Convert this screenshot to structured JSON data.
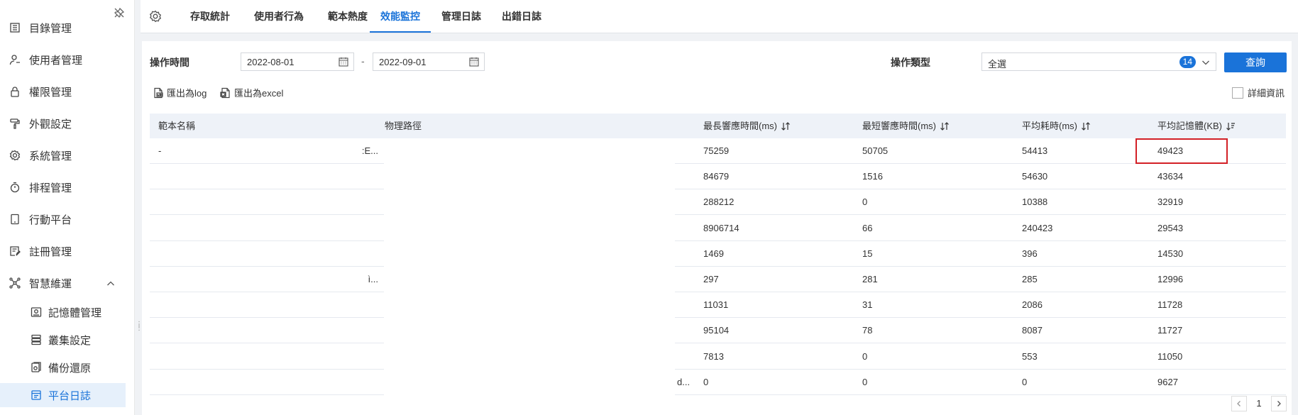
{
  "sidebar": {
    "items": [
      {
        "label": "目錄管理",
        "icon": "list-icon"
      },
      {
        "label": "使用者管理",
        "icon": "user-icon"
      },
      {
        "label": "權限管理",
        "icon": "lock-icon"
      },
      {
        "label": "外觀設定",
        "icon": "paint-roller-icon"
      },
      {
        "label": "系統管理",
        "icon": "gear-icon"
      },
      {
        "label": "排程管理",
        "icon": "timer-icon"
      },
      {
        "label": "行動平台",
        "icon": "tablet-icon"
      },
      {
        "label": "註冊管理",
        "icon": "register-icon"
      },
      {
        "label": "智慧維運",
        "icon": "network-icon"
      }
    ],
    "sub_items": [
      {
        "label": "記憶體管理",
        "icon": "memory-icon"
      },
      {
        "label": "叢集設定",
        "icon": "cluster-icon"
      },
      {
        "label": "備份還原",
        "icon": "backup-icon"
      },
      {
        "label": "平台日誌",
        "icon": "log-icon"
      }
    ]
  },
  "tabs": [
    "存取統計",
    "使用者行為",
    "範本熱度",
    "效能監控",
    "管理日誌",
    "出錯日誌"
  ],
  "active_tab": "效能監控",
  "filters": {
    "time_label": "操作時間",
    "start_date": "2022-08-01",
    "date_separator": "-",
    "end_date": "2022-09-01",
    "type_label": "操作類型",
    "type_value": "全選",
    "type_count": "14",
    "query_button": "查詢"
  },
  "toolbar": {
    "export_log": "匯出為log",
    "export_excel": "匯出為excel",
    "detail_checkbox": "詳細資訊"
  },
  "table": {
    "headers": [
      "範本名稱",
      "物理路徑",
      "最長響應時間(ms)",
      "最短響應時間(ms)",
      "平均耗時(ms)",
      "平均記憶體(KB)"
    ],
    "rows": [
      {
        "name": "-",
        "path_tail": ":E...",
        "max": "75259",
        "min": "50705",
        "avg": "54413",
        "mem": "49423"
      },
      {
        "name": "",
        "path_tail": "",
        "max": "84679",
        "min": "1516",
        "avg": "54630",
        "mem": "43634"
      },
      {
        "name": "",
        "path_tail": "",
        "max": "288212",
        "min": "0",
        "avg": "10388",
        "mem": "32919"
      },
      {
        "name": "",
        "path_tail": "",
        "max": "8906714",
        "min": "66",
        "avg": "240423",
        "mem": "29543"
      },
      {
        "name": "",
        "path_tail": "",
        "max": "1469",
        "min": "15",
        "avg": "396",
        "mem": "14530"
      },
      {
        "name": "",
        "path_tail": "ì...",
        "max": "297",
        "min": "281",
        "avg": "285",
        "mem": "12996"
      },
      {
        "name": "",
        "path_tail": "",
        "max": "11031",
        "min": "31",
        "avg": "2086",
        "mem": "11728"
      },
      {
        "name": "",
        "path_tail": "",
        "max": "95104",
        "min": "78",
        "avg": "8087",
        "mem": "11727"
      },
      {
        "name": "",
        "path_tail": "",
        "max": "7813",
        "min": "0",
        "avg": "553",
        "mem": "11050"
      },
      {
        "name": "",
        "path_tail": "d...",
        "max": "0",
        "min": "0",
        "avg": "0",
        "mem": "9627"
      }
    ]
  },
  "pagination": {
    "current": "1"
  },
  "colors": {
    "accent": "#1a73d9",
    "highlight": "#d32026"
  }
}
